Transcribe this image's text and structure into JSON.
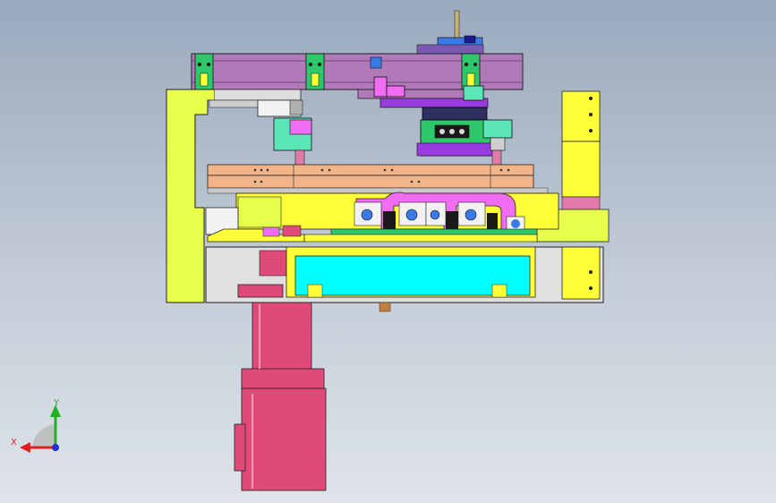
{
  "view": {
    "background_top": "#9aa9bd",
    "background_bottom": "#dfe4ea"
  },
  "triad": {
    "x_label": "X",
    "y_label": "Y",
    "x_color": "#e02020",
    "y_color": "#20b020",
    "z_color": "#2030d0"
  },
  "colors": {
    "purple_beam": "#b07ab8",
    "lime": "#e6ff4a",
    "yellow": "#ffff3a",
    "salmon": "#f2b58a",
    "cyan": "#00ffff",
    "magenta": "#f06cf0",
    "pink_motor": "#e04a78",
    "teal": "#5ae6b8",
    "green_part": "#2ec86a",
    "blue_part": "#3a7ae8",
    "gray_plate": "#d8d8d8",
    "white_block": "#f2f2f2",
    "dark": "#202020"
  }
}
